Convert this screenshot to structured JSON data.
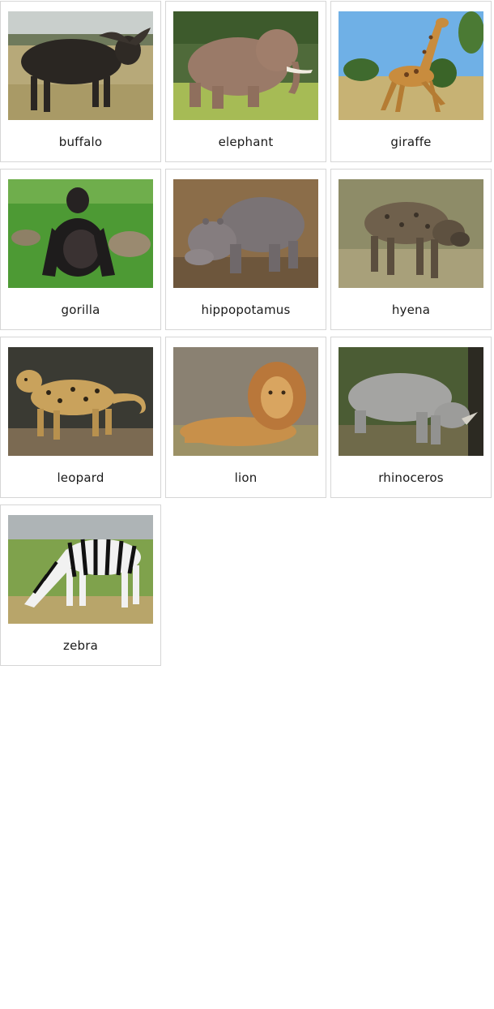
{
  "cards": [
    {
      "label": "buffalo",
      "image": "buffalo-photo"
    },
    {
      "label": "elephant",
      "image": "elephant-photo"
    },
    {
      "label": "giraffe",
      "image": "giraffe-photo"
    },
    {
      "label": "gorilla",
      "image": "gorilla-photo"
    },
    {
      "label": "hippopotamus",
      "image": "hippopotamus-photo"
    },
    {
      "label": "hyena",
      "image": "hyena-photo"
    },
    {
      "label": "leopard",
      "image": "leopard-photo"
    },
    {
      "label": "lion",
      "image": "lion-photo"
    },
    {
      "label": "rhinoceros",
      "image": "rhinoceros-photo"
    },
    {
      "label": "zebra",
      "image": "zebra-photo"
    }
  ],
  "colors": {
    "card_border": "#d6d6d6",
    "label_text": "#1a1a1a",
    "background": "#ffffff"
  }
}
